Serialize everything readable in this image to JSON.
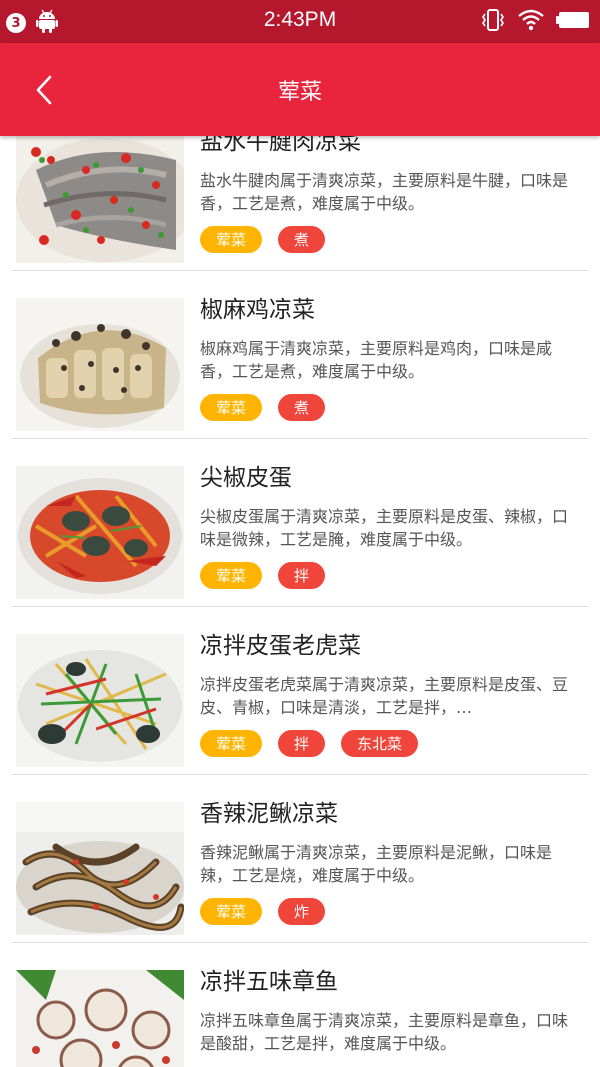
{
  "status_bar": {
    "notification_count": "3",
    "time": "2:43PM",
    "icons": [
      "android-icon",
      "vibrate-icon",
      "wifi-icon",
      "battery-icon"
    ]
  },
  "app_bar": {
    "title": "荤菜",
    "back_icon": "chevron-left-icon"
  },
  "colors": {
    "status_bar": "#b5172d",
    "app_bar": "#e8253d",
    "tag_category": "#ffb400",
    "tag_method": "#f0453a"
  },
  "dishes": [
    {
      "name": "盐水牛腱肉凉菜",
      "desc": "盐水牛腱肉属于清爽凉菜，主要原料是牛腱，口味是香，工艺是煮，难度属于中级。",
      "tags": [
        "荤菜",
        "煮"
      ]
    },
    {
      "name": "椒麻鸡凉菜",
      "desc": "椒麻鸡属于清爽凉菜，主要原料是鸡肉，口味是咸香，工艺是煮，难度属于中级。",
      "tags": [
        "荤菜",
        "煮"
      ]
    },
    {
      "name": "尖椒皮蛋",
      "desc": "尖椒皮蛋属于清爽凉菜，主要原料是皮蛋、辣椒，口味是微辣，工艺是腌，难度属于中级。",
      "tags": [
        "荤菜",
        "拌"
      ]
    },
    {
      "name": "凉拌皮蛋老虎菜",
      "desc": "凉拌皮蛋老虎菜属于清爽凉菜，主要原料是皮蛋、豆皮、青椒，口味是清淡，工艺是拌，…",
      "tags": [
        "荤菜",
        "拌",
        "东北菜"
      ]
    },
    {
      "name": "香辣泥鳅凉菜",
      "desc": "香辣泥鳅属于清爽凉菜，主要原料是泥鳅，口味是辣，工艺是烧，难度属于中级。",
      "tags": [
        "荤菜",
        "炸"
      ]
    },
    {
      "name": "凉拌五味章鱼",
      "desc": "凉拌五味章鱼属于清爽凉菜，主要原料是章鱼，口味是酸甜，工艺是拌，难度属于中级。",
      "tags": []
    }
  ]
}
